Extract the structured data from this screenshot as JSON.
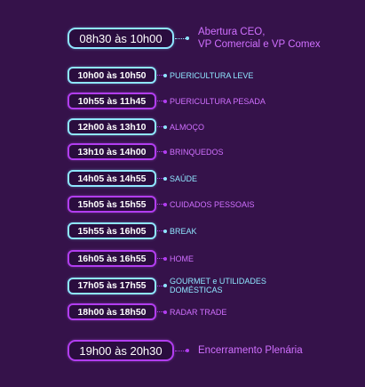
{
  "opening": {
    "time": "08h30 às 10h00",
    "label_line1": "Abertura CEO,",
    "label_line2": "VP Comercial e VP Comex"
  },
  "slots": [
    {
      "time": "10h00 às 10h50",
      "label": "PUERICULTURA LEVE",
      "label2": ""
    },
    {
      "time": "10h55 às 11h45",
      "label": "PUERICULTURA PESADA",
      "label2": ""
    },
    {
      "time": "12h00 às 13h10",
      "label": "ALMOÇO",
      "label2": ""
    },
    {
      "time": "13h10 às 14h00",
      "label": "BRINQUEDOS",
      "label2": ""
    },
    {
      "time": "14h05 às 14h55",
      "label": "SAÚDE",
      "label2": ""
    },
    {
      "time": "15h05 às 15h55",
      "label": "CUIDADOS PESSOAIS",
      "label2": ""
    },
    {
      "time": "15h55 às 16h05",
      "label": "BREAK",
      "label2": ""
    },
    {
      "time": "16h05 às 16h55",
      "label": "HOME",
      "label2": ""
    },
    {
      "time": "17h05 às 17h55",
      "label": "GOURMET e UTILIDADES",
      "label2": "DOMÉSTICAS"
    },
    {
      "time": "18h00 às 18h50",
      "label": "RADAR TRADE",
      "label2": ""
    }
  ],
  "closing": {
    "time": "19h00 às 20h30",
    "label": "Encerramento Plenária"
  },
  "colors": {
    "background": "#35124a",
    "magenta": "#b23df0",
    "cyan": "#8fe6ff",
    "label_magenta": "#d070ff"
  }
}
